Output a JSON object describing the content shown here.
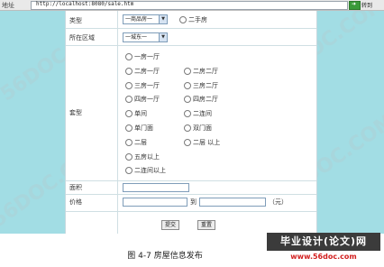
{
  "browser": {
    "address_label": "地址",
    "url": "http://localhost:8080/sale.htm",
    "go_label": "转到",
    "links_label": "转到"
  },
  "form": {
    "type_label": "类型",
    "type_select": "一商品房一",
    "type_radio_label": "二手房",
    "area_label": "所在区域",
    "area_select": "一城东一",
    "house_type_label": "套型",
    "house_types_left": [
      "一房一厅",
      "二房一厅",
      "三房一厅",
      "四房一厅",
      "单间",
      "单门面",
      "二层",
      "五房以上",
      "二连间以上"
    ],
    "house_types_right": [
      "",
      "二房二厅",
      "三房二厅",
      "四房二厅",
      "二连间",
      "双门面",
      "二层 以上",
      "",
      ""
    ],
    "size_label": "面积",
    "price_label": "价格",
    "price_to": "到",
    "price_unit": "（元）",
    "submit_label": "提交",
    "reset_label": "重置"
  },
  "caption": "图 4-7  房屋信息发布",
  "watermark": {
    "site_text": "56DOC.COM",
    "logo_title": "毕业设计(论文)网",
    "logo_url": "www.56doc.com"
  },
  "colors": {
    "page_bg": "#a2dde4",
    "form_bg": "#ffffff",
    "logo_bg": "#3b3b3b",
    "logo_url_color": "#d21f1f"
  }
}
